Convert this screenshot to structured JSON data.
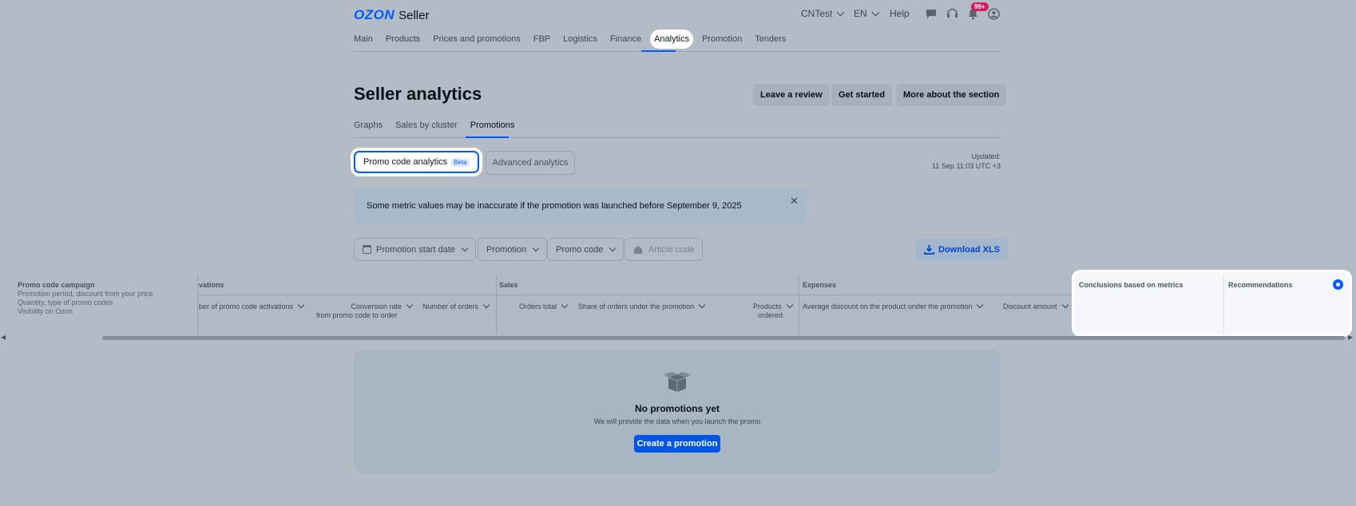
{
  "header": {
    "logo_brand": "OZON",
    "logo_product": "Seller",
    "account": "CNTest",
    "language": "EN",
    "help": "Help",
    "notifications_badge": "99+"
  },
  "topnav": [
    "Main",
    "Products",
    "Prices and promotions",
    "FBP",
    "Logistics",
    "Finance",
    "Analytics",
    "Promotion",
    "Tenders"
  ],
  "page": {
    "title": "Seller analytics",
    "buttons": [
      "Leave a review",
      "Get started",
      "More about the section"
    ]
  },
  "subtabs": [
    "Graphs",
    "Sales by cluster",
    "Promotions"
  ],
  "segments": {
    "active": "Promo code analytics",
    "active_badge": "Beta",
    "other": "Advanced analytics"
  },
  "updated": {
    "label": "Updated:",
    "value": "11 Sep 11:03 UTC +3"
  },
  "notice": {
    "text": "Some metric values may be inaccurate if the promotion was launched before September 9, 2025"
  },
  "filters": {
    "start_date": "Promotion start date",
    "promotion": "Promotion",
    "promo_code": "Promo code",
    "article_code": "Article code",
    "download": "Download XLS"
  },
  "table": {
    "frozen": {
      "title": "Promo code campaign",
      "lines": [
        "Promotion period, discount from your price",
        "Quantity, type of promo codes",
        "Visibility on Ozon"
      ]
    },
    "groups": {
      "activations": "vations",
      "sales": "Sales",
      "expenses": "Expenses",
      "conclusions": "Conclusions based on metrics",
      "recommendations": "Recommendations"
    },
    "columns": {
      "activations_count": "ber of promo code activations",
      "conversion_1": "Conversion rate",
      "conversion_2": "from promo code to order",
      "orders_count": "Number of orders",
      "orders_total": "Orders total",
      "share_orders": "Share of orders under the promotion",
      "products_1": "Products",
      "products_2": "ordered",
      "avg_discount": "Average discount on the product under the promotion",
      "discount_amount": "Discount amount"
    }
  },
  "empty": {
    "title": "No promotions yet",
    "subtitle": "We will provide the data when you launch the promo",
    "button": "Create a promotion"
  }
}
